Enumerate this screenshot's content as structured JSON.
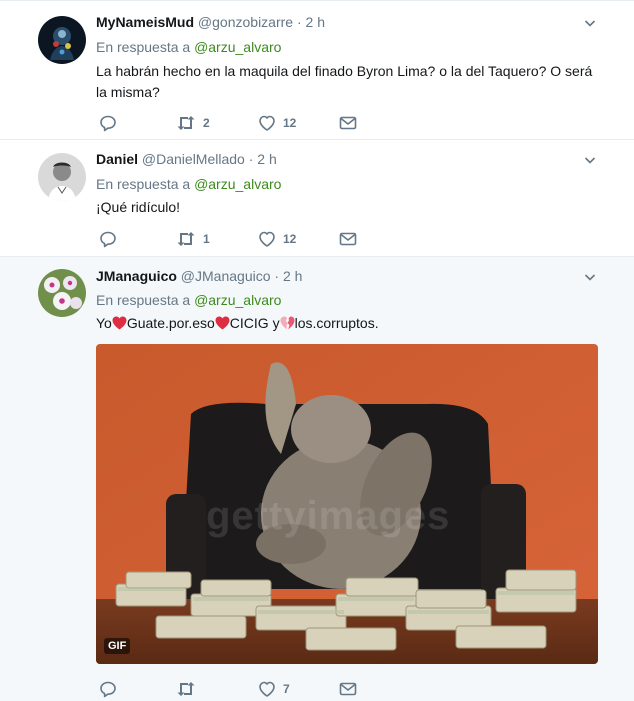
{
  "tweets": [
    {
      "name": "MyNameisMud",
      "handle": "@gonzobizarre",
      "dot": "·",
      "time": "2 h",
      "reply_prefix": "En respuesta a",
      "reply_to": "@arzu_alvaro",
      "text": "La habrán hecho en la maquila del finado Byron Lima? o la del Taquero? O será la misma?",
      "retweets": "2",
      "likes": "12"
    },
    {
      "name": "Daniel",
      "handle": "@DanielMellado",
      "dot": "·",
      "time": "2 h",
      "reply_prefix": "En respuesta a",
      "reply_to": "@arzu_alvaro",
      "text": "¡Qué ridículo!",
      "retweets": "1",
      "likes": "12"
    },
    {
      "name": "JManaguico",
      "handle": "@JManaguico",
      "dot": "·",
      "time": "2 h",
      "reply_prefix": "En respuesta a",
      "reply_to": "@arzu_alvaro",
      "text_parts": [
        "Yo",
        "Guate.por.eso",
        "CICIG y",
        "los.corruptos."
      ],
      "likes": "7",
      "media_badge": "GIF",
      "media_watermark": "gettyimages"
    }
  ],
  "icons": [
    "reply-icon",
    "retweet-icon",
    "like-icon",
    "direct-message-icon",
    "caret-down-icon",
    "red-heart-emoji",
    "broken-heart-emoji"
  ],
  "colors": {
    "mention": "#3d8a1e",
    "meta": "#657786",
    "divider": "#e6ecf0",
    "highlight_bg": "#f5f8fa",
    "heart": "#dd2e44"
  }
}
